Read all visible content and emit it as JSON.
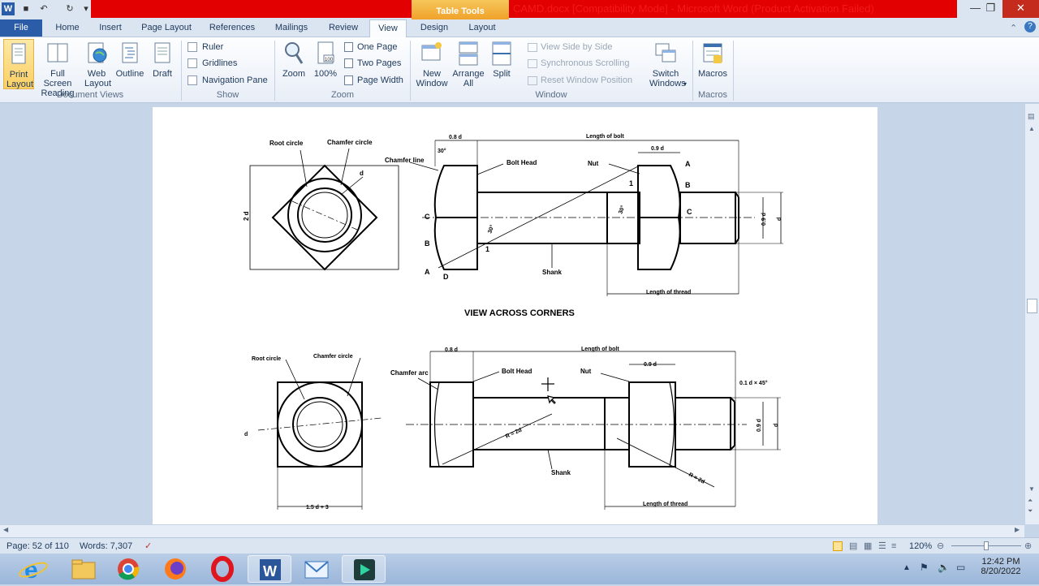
{
  "window": {
    "title": "CAMD.docx [Compatibility Mode] - Microsoft Word (Product Activation Failed)",
    "contextual_tab": "Table Tools",
    "minimize": "—",
    "maximize": "❐",
    "close": "✕"
  },
  "tabs": [
    "File",
    "Home",
    "Insert",
    "Page Layout",
    "References",
    "Mailings",
    "Review",
    "View",
    "Design",
    "Layout"
  ],
  "ribbon": {
    "document_views": {
      "label": "Document Views",
      "buttons": [
        "Print Layout",
        "Full Screen Reading",
        "Web Layout",
        "Outline",
        "Draft"
      ]
    },
    "show": {
      "label": "Show",
      "checkboxes": [
        "Ruler",
        "Gridlines",
        "Navigation Pane"
      ]
    },
    "zoom": {
      "label": "Zoom",
      "buttons": [
        "Zoom",
        "100%"
      ],
      "small": [
        "One Page",
        "Two Pages",
        "Page Width"
      ]
    },
    "window": {
      "label": "Window",
      "buttons": [
        "New Window",
        "Arrange All",
        "Split"
      ],
      "small": [
        "View Side by Side",
        "Synchronous Scrolling",
        "Reset Window Position"
      ],
      "switch": "Switch Windows"
    },
    "macros": {
      "label": "Macros",
      "button": "Macros"
    }
  },
  "drawing": {
    "top": {
      "root_circle": "Root circle",
      "chamfer_circle": "Chamfer circle",
      "d": "d",
      "two_d": "2 d",
      "dim_08d": "0.8 d",
      "length_bolt": "Length of bolt",
      "dim_09d": "0.9 d",
      "chamfer_line": "Chamfer line",
      "bolt_head": "Bolt Head",
      "nut": "Nut",
      "angle30a": "30°",
      "angle30b": "30°",
      "angle30c": "30°",
      "A": "A",
      "B": "B",
      "C": "C",
      "D": "D",
      "one": "1",
      "shank": "Shank",
      "length_thread": "Length of thread",
      "dim_09d_v": "0.9 d",
      "d_v": "d",
      "caption": "VIEW ACROSS CORNERS"
    },
    "bottom": {
      "root_circle": "Root circle",
      "chamfer_circle": "Chamfer circle",
      "d": "d",
      "dim_08d": "0.8 d",
      "length_bolt": "Length of bolt",
      "dim_09d": "0.9 d",
      "chamfer_arc": "Chamfer arc",
      "bolt_head": "Bolt Head",
      "nut": "Nut",
      "chamfer_note": "0.1 d × 45°",
      "r2d": "R = 2d",
      "r2d_b": "R = 2d",
      "shank": "Shank",
      "width": "1.5 d + 3",
      "length_thread": "Length of thread",
      "dim_09d_v": "0.9 d",
      "d_v": "d"
    }
  },
  "status": {
    "page": "Page: 52 of 110",
    "words": "Words: 7,307",
    "zoom": "120%"
  },
  "clock": {
    "time": "12:42 PM",
    "date": "8/20/2022"
  }
}
